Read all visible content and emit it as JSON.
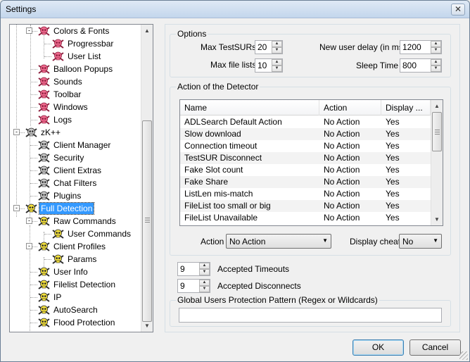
{
  "window": {
    "title": "Settings",
    "close_glyph": "✕"
  },
  "tree": {
    "items": [
      {
        "label": "Colors & Fonts",
        "level": 2,
        "icon": "pink-skull-icon",
        "toggle": "-"
      },
      {
        "label": "Progressbar",
        "level": 3,
        "icon": "pink-skull-icon"
      },
      {
        "label": "User List",
        "level": 3,
        "icon": "pink-skull-icon"
      },
      {
        "label": "Balloon Popups",
        "level": 2,
        "icon": "pink-skull-icon"
      },
      {
        "label": "Sounds",
        "level": 2,
        "icon": "pink-skull-icon"
      },
      {
        "label": "Toolbar",
        "level": 2,
        "icon": "pink-skull-icon"
      },
      {
        "label": "Windows",
        "level": 2,
        "icon": "pink-skull-icon"
      },
      {
        "label": "Logs",
        "level": 2,
        "icon": "pink-skull-icon"
      },
      {
        "label": "zK++",
        "level": 1,
        "icon": "gray-skull-icon",
        "toggle": "-"
      },
      {
        "label": "Client Manager",
        "level": 2,
        "icon": "gray-skull-icon"
      },
      {
        "label": "Security",
        "level": 2,
        "icon": "gray-skull-icon"
      },
      {
        "label": "Client Extras",
        "level": 2,
        "icon": "gray-skull-icon"
      },
      {
        "label": "Chat Filters",
        "level": 2,
        "icon": "gray-skull-icon"
      },
      {
        "label": "Plugins",
        "level": 2,
        "icon": "gray-skull-icon"
      },
      {
        "label": "Full Detection",
        "level": 1,
        "icon": "yellow-skull-icon",
        "toggle": "-",
        "selected": true
      },
      {
        "label": "Raw Commands",
        "level": 2,
        "icon": "yellow-skull-icon",
        "toggle": "-"
      },
      {
        "label": "User Commands",
        "level": 3,
        "icon": "yellow-skull-icon"
      },
      {
        "label": "Client Profiles",
        "level": 2,
        "icon": "yellow-skull-icon",
        "toggle": "-"
      },
      {
        "label": "Params",
        "level": 3,
        "icon": "yellow-skull-icon"
      },
      {
        "label": "User Info",
        "level": 2,
        "icon": "yellow-skull-icon"
      },
      {
        "label": "Filelist Detection",
        "level": 2,
        "icon": "yellow-skull-icon"
      },
      {
        "label": "IP",
        "level": 2,
        "icon": "yellow-skull-icon"
      },
      {
        "label": "AutoSearch",
        "level": 2,
        "icon": "yellow-skull-icon"
      },
      {
        "label": "Flood Protection",
        "level": 2,
        "icon": "yellow-skull-icon"
      }
    ]
  },
  "options": {
    "title": "Options",
    "max_testsurs": {
      "label": "Max TestSURs",
      "value": "20"
    },
    "max_file_lists": {
      "label": "Max file lists",
      "value": "10"
    },
    "new_user_delay": {
      "label": "New user delay (in ms)",
      "value": "1200"
    },
    "sleep_time": {
      "label": "Sleep Time",
      "value": "800"
    }
  },
  "detector": {
    "title": "Action of the Detector",
    "columns": [
      "Name",
      "Action",
      "Display ..."
    ],
    "rows": [
      [
        "ADLSearch Default Action",
        "No Action",
        "Yes"
      ],
      [
        "Slow download",
        "No Action",
        "Yes"
      ],
      [
        "Connection timeout",
        "No Action",
        "Yes"
      ],
      [
        "TestSUR Disconnect",
        "No Action",
        "Yes"
      ],
      [
        "Fake Slot count",
        "No Action",
        "Yes"
      ],
      [
        "Fake Share",
        "No Action",
        "Yes"
      ],
      [
        "ListLen mis-match",
        "No Action",
        "Yes"
      ],
      [
        "FileList too small or big",
        "No Action",
        "Yes"
      ],
      [
        "FileList Unavailable",
        "No Action",
        "Yes"
      ]
    ],
    "action_label": "Action",
    "action_value": "No Action",
    "display_cheat_label": "Display cheat",
    "display_cheat_value": "No"
  },
  "accepted_timeouts": {
    "label": "Accepted Timeouts",
    "value": "9"
  },
  "accepted_disconnects": {
    "label": "Accepted Disconnects",
    "value": "9"
  },
  "protection": {
    "title": "Global Users Protection Pattern (Regex or Wildcards)",
    "value": ""
  },
  "buttons": {
    "ok": "OK",
    "cancel": "Cancel"
  }
}
